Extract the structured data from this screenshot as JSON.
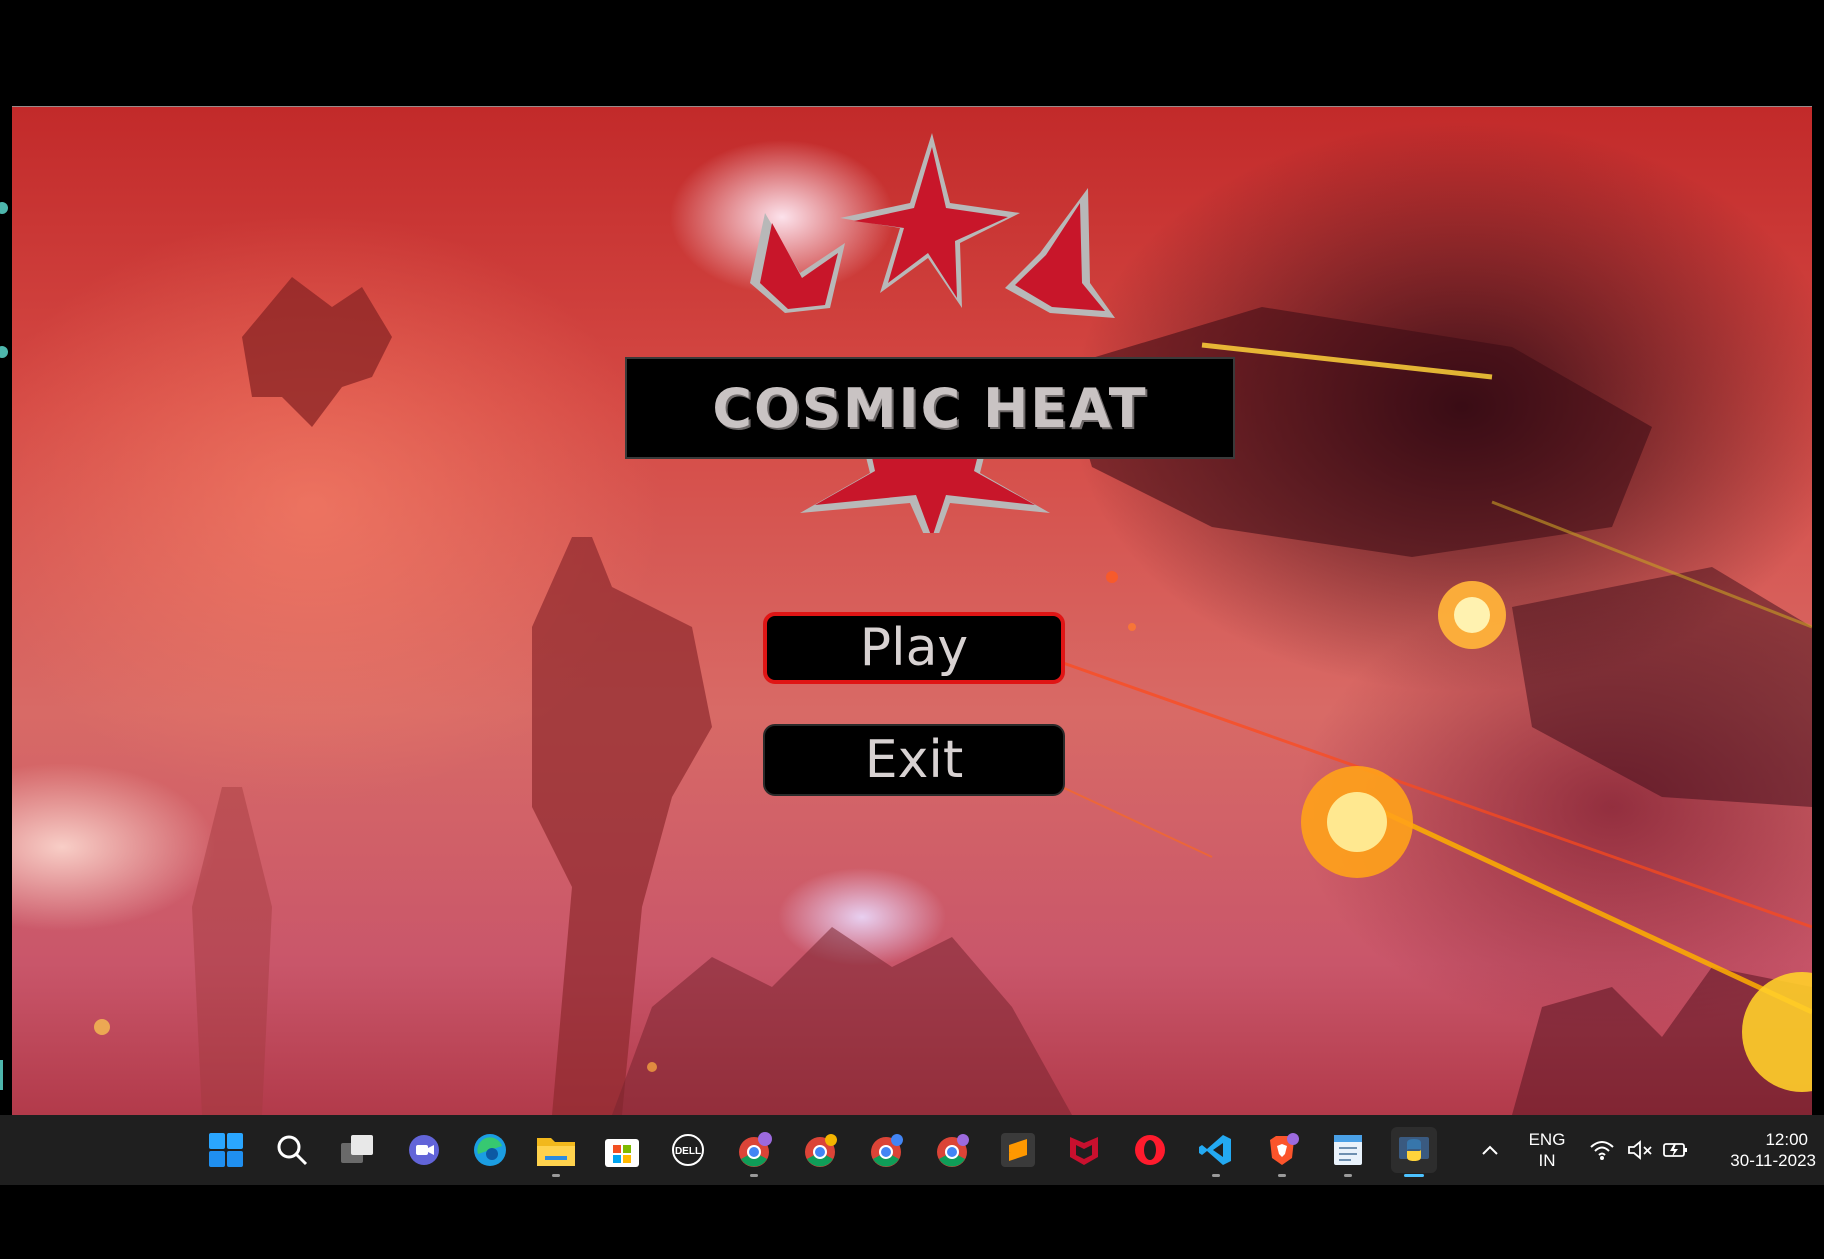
{
  "game": {
    "title": "COSMIC HEAT",
    "menu": {
      "play_label": "Play",
      "exit_label": "Exit",
      "selected": "Play"
    },
    "colors": {
      "accent": "#e01515",
      "star": "#c8162a",
      "button_bg": "#000000",
      "title_text": "#c9c3c3"
    }
  },
  "taskbar": {
    "icons": [
      "windows-start-icon",
      "search-icon",
      "task-view-icon",
      "teams-chat-icon",
      "edge-icon",
      "file-explorer-icon",
      "microsoft-store-icon",
      "dell-icon",
      "chrome-profile-1-icon",
      "chrome-profile-2-icon",
      "chrome-profile-3-icon",
      "chrome-profile-4-icon",
      "sublime-text-icon",
      "mcafee-icon",
      "opera-icon",
      "vscode-icon",
      "brave-icon",
      "notepad-icon",
      "python-icon"
    ],
    "tray": {
      "language_line1": "ENG",
      "language_line2": "IN",
      "time": "12:00",
      "date": "30-11-2023"
    }
  }
}
